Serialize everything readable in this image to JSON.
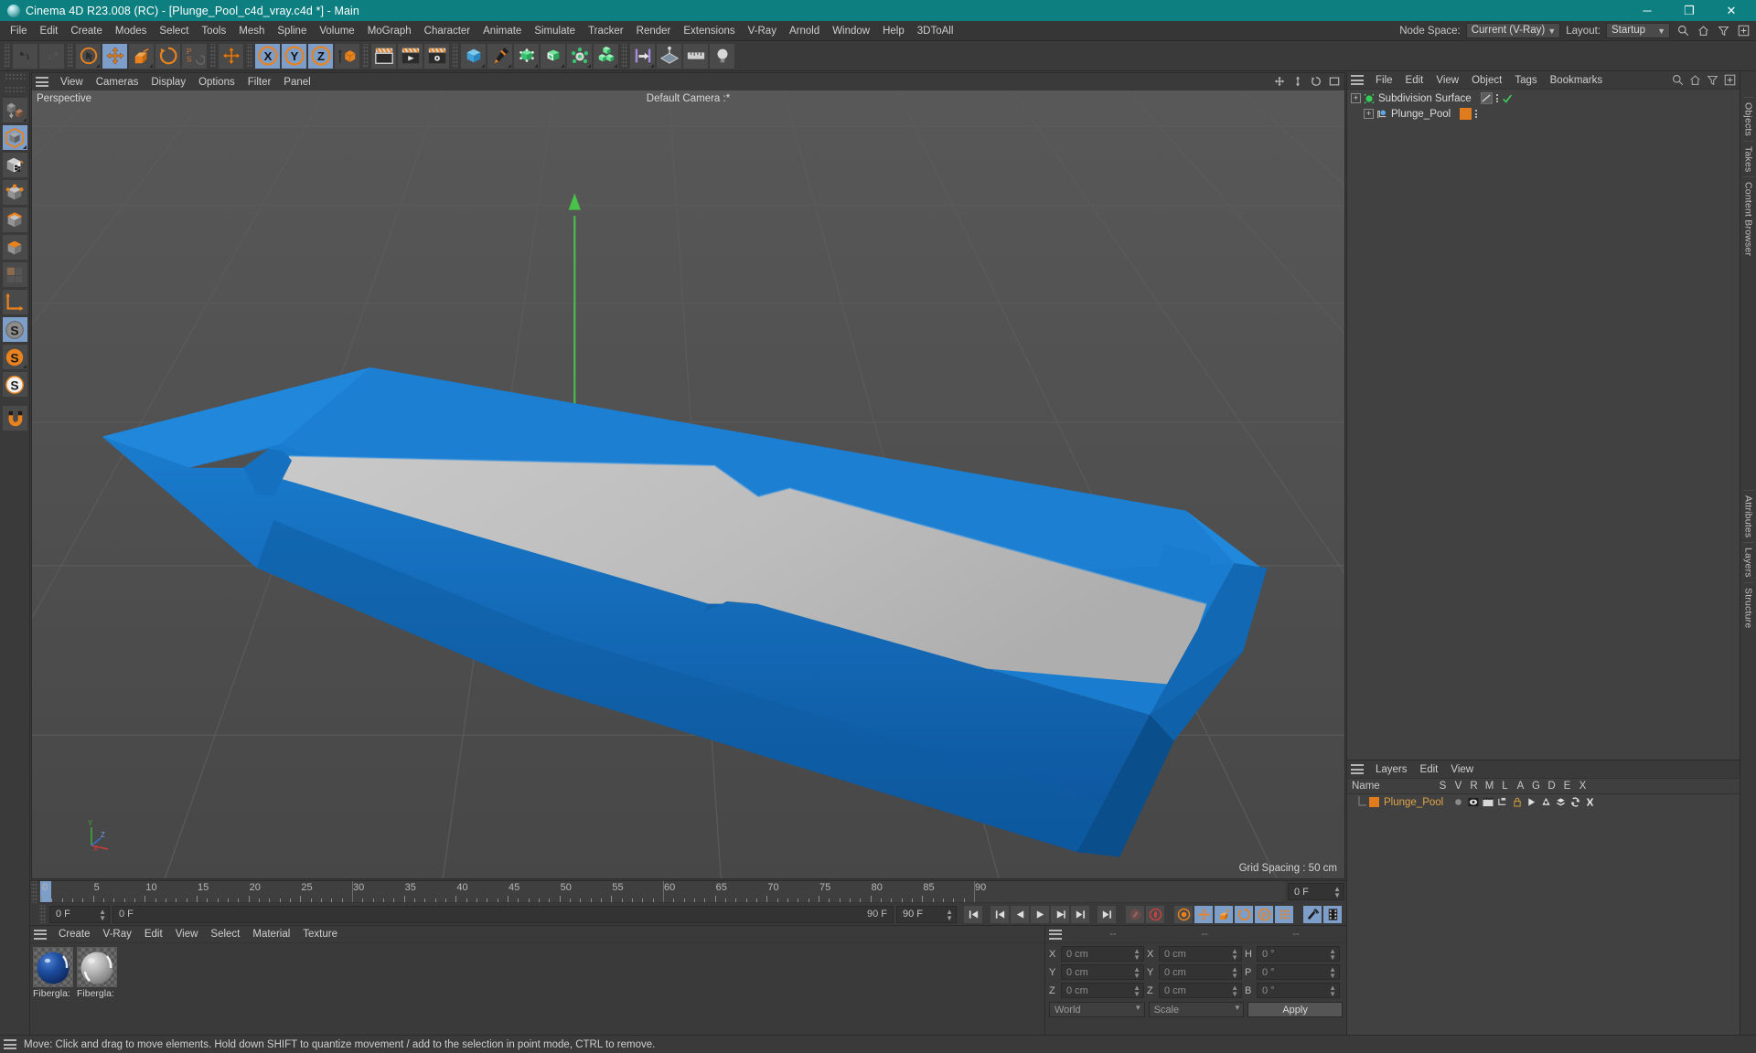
{
  "titlebar": {
    "title": "Cinema 4D R23.008 (RC) - [Plunge_Pool_c4d_vray.c4d *] - Main",
    "minimize": "─",
    "maximize": "❐",
    "close": "✕",
    "logo_icon": "c4d-logo-icon"
  },
  "menubar": {
    "items": [
      "File",
      "Edit",
      "Create",
      "Modes",
      "Select",
      "Tools",
      "Mesh",
      "Spline",
      "Volume",
      "MoGraph",
      "Character",
      "Animate",
      "Simulate",
      "Tracker",
      "Render",
      "Extensions",
      "V-Ray",
      "Arnold",
      "Window",
      "Help",
      "3DToAll"
    ],
    "node_space_label": "Node Space:",
    "node_space_value": "Current (V-Ray)",
    "layout_label": "Layout:",
    "layout_value": "Startup",
    "icons": [
      "search-icon",
      "home-icon",
      "filter-icon",
      "add-icon"
    ]
  },
  "toolbar": {
    "groups": [
      {
        "name": "history",
        "buttons": [
          {
            "name": "undo-button",
            "icon": "undo-arrow",
            "selected": false
          },
          {
            "name": "redo-button",
            "icon": "redo-arrow",
            "selected": false
          }
        ]
      },
      {
        "name": "transform",
        "buttons": [
          {
            "name": "select-tool-button",
            "icon": "live-selection",
            "selected": false
          },
          {
            "name": "move-tool-button",
            "icon": "move-cross",
            "selected": true
          },
          {
            "name": "scale-tool-button",
            "icon": "scale-box",
            "selected": false
          },
          {
            "name": "rotate-tool-button",
            "icon": "rotate-circle",
            "selected": false
          },
          {
            "name": "ps-tool-button",
            "icon": "ps-letters",
            "selected": false
          }
        ]
      },
      {
        "name": "axis",
        "buttons": [
          {
            "name": "world-axis-button",
            "icon": "move-cross",
            "selected": false
          }
        ]
      },
      {
        "name": "locks",
        "buttons": [
          {
            "name": "lock-x-button",
            "icon": "x-axis-lock",
            "selected": true
          },
          {
            "name": "lock-y-button",
            "icon": "y-axis-lock",
            "selected": true
          },
          {
            "name": "lock-z-button",
            "icon": "z-axis-lock",
            "selected": true
          },
          {
            "name": "world-object-button",
            "icon": "world-cube",
            "selected": false
          }
        ]
      },
      {
        "name": "render",
        "buttons": [
          {
            "name": "render-view-button",
            "icon": "render-clapper",
            "selected": false
          },
          {
            "name": "render-to-picture-button",
            "icon": "render-play",
            "selected": false
          },
          {
            "name": "render-settings-button",
            "icon": "render-gear",
            "selected": false
          }
        ]
      },
      {
        "name": "create",
        "buttons": [
          {
            "name": "add-cube-button",
            "icon": "blue-cube",
            "selected": false
          },
          {
            "name": "add-spline-button",
            "icon": "pen-nib",
            "selected": false
          },
          {
            "name": "add-generator-button",
            "icon": "green-cube-points",
            "selected": false
          },
          {
            "name": "add-deformer-button",
            "icon": "green-bend-cube",
            "selected": false
          },
          {
            "name": "add-scene-button",
            "icon": "gray-sphere-nodes",
            "selected": false
          },
          {
            "name": "add-mograph-button",
            "icon": "green-cubes-stack",
            "selected": false
          }
        ]
      },
      {
        "name": "snap",
        "buttons": [
          {
            "name": "snap-button",
            "icon": "magnet-arrow",
            "selected": false
          },
          {
            "name": "workplane-button",
            "icon": "workplane-grid",
            "selected": false
          },
          {
            "name": "ruler-button",
            "icon": "ruler-icon",
            "selected": false
          },
          {
            "name": "light-button",
            "icon": "bulb-icon",
            "selected": false
          }
        ]
      }
    ]
  },
  "leftbar": {
    "buttons": [
      {
        "name": "make-editable-button",
        "icon": "make-editable",
        "selected": false
      },
      {
        "name": "model-mode-button",
        "icon": "gray-cube",
        "selected": true
      },
      {
        "name": "texture-mode-button",
        "icon": "checker-cube",
        "selected": false
      },
      {
        "name": "points-mode-button",
        "icon": "points-cube",
        "selected": false
      },
      {
        "name": "edges-mode-button",
        "icon": "edges-cube",
        "selected": false
      },
      {
        "name": "polygons-mode-button",
        "icon": "polygons-cube",
        "selected": false
      },
      {
        "name": "uv-mode-button",
        "icon": "uv-squares",
        "selected": false
      },
      {
        "name": "axis-mode-button",
        "icon": "axis-corner",
        "selected": false
      },
      {
        "name": "enable-axis-button",
        "icon": "s-circle-gray",
        "selected": true
      },
      {
        "name": "enable-snap-button",
        "icon": "s-circle-orange",
        "selected": false
      },
      {
        "name": "workplane-lock-button",
        "icon": "s-circle-white",
        "selected": false
      },
      {
        "name": "magnet-button",
        "icon": "magnet-orange",
        "selected": false
      }
    ]
  },
  "viewport": {
    "menu_items": [
      "View",
      "Cameras",
      "Display",
      "Options",
      "Filter",
      "Panel"
    ],
    "label_top_left": "Perspective",
    "label_top_center": "Default Camera :*",
    "grid_spacing": "Grid Spacing : 50 cm",
    "axis_labels": {
      "x": "X",
      "y": "Y",
      "z": "Z"
    },
    "gizmo_icons": [
      "pan-icon",
      "dolly-icon",
      "rotate-icon",
      "maximize-icon"
    ],
    "colors": {
      "background_top": "#555555",
      "background_bottom": "#474747",
      "pool_blue": "#1878c8",
      "pool_blue_dark": "#1161a4",
      "pool_inner_gray": "#bcbcbc",
      "axis_green": "#49c24a"
    }
  },
  "timeline": {
    "ticks": [
      0,
      5,
      10,
      15,
      20,
      25,
      30,
      35,
      40,
      45,
      50,
      55,
      60,
      65,
      70,
      75,
      80,
      85,
      90
    ],
    "current_frame": "0 F",
    "range_start": "0 F",
    "range_end": "90 F",
    "preview_min": "90 F",
    "preview_max": "90 F",
    "end_field": "0 F",
    "transport": [
      {
        "name": "goto-start-button",
        "icon": "skip-start"
      },
      {
        "name": "step-back-key-button",
        "icon": "prev-key"
      },
      {
        "name": "step-back-button",
        "icon": "step-back"
      },
      {
        "name": "play-button",
        "icon": "play"
      },
      {
        "name": "step-forward-button",
        "icon": "step-forward"
      },
      {
        "name": "next-key-button",
        "icon": "next-key"
      },
      {
        "name": "goto-end-button",
        "icon": "skip-end"
      }
    ],
    "record_buttons": [
      {
        "name": "record-active-objects-button",
        "icon": "record-key",
        "selected": false
      },
      {
        "name": "autokeying-button",
        "icon": "autokey-circle",
        "selected": false
      },
      {
        "name": "keyframe-selection-button",
        "icon": "key-gear",
        "selected": false
      },
      {
        "name": "position-key-button",
        "icon": "move-cross",
        "selected": true
      },
      {
        "name": "scale-key-button",
        "icon": "scale-box",
        "selected": true
      },
      {
        "name": "rotation-key-button",
        "icon": "rotate-circle",
        "selected": true
      },
      {
        "name": "pla-key-button",
        "icon": "p-circle",
        "selected": true
      },
      {
        "name": "point-level-animation-button",
        "icon": "dots-grid",
        "selected": true
      },
      {
        "name": "sound-button",
        "icon": "sound-waves",
        "selected": true
      },
      {
        "name": "filmstrip-button",
        "icon": "filmstrip",
        "selected": true
      }
    ]
  },
  "material_manager": {
    "menu_items": [
      "Create",
      "V-Ray",
      "Edit",
      "View",
      "Select",
      "Material",
      "Texture"
    ],
    "materials": [
      {
        "name": "Fiberglas",
        "display": "Fibergla:",
        "color": "#1b4f9c",
        "type": "glossy-blue"
      },
      {
        "name": "Fiberglas",
        "display": "Fibergla:",
        "color": "#b8b8b8",
        "type": "glossy-gray"
      }
    ]
  },
  "coordinates": {
    "headers": [
      "--",
      "--",
      "--"
    ],
    "rows": [
      {
        "axis1": "X",
        "val1": "0 cm",
        "axis2": "X",
        "val2": "0 cm",
        "axis3": "H",
        "val3": "0 °"
      },
      {
        "axis1": "Y",
        "val1": "0 cm",
        "axis2": "Y",
        "val2": "0 cm",
        "axis3": "P",
        "val3": "0 °"
      },
      {
        "axis1": "Z",
        "val1": "0 cm",
        "axis2": "Z",
        "val2": "0 cm",
        "axis3": "B",
        "val3": "0 °"
      }
    ],
    "space_value": "World",
    "mode_value": "Scale",
    "apply_label": "Apply"
  },
  "object_manager": {
    "menu_items": [
      "File",
      "Edit",
      "View",
      "Object",
      "Tags",
      "Bookmarks"
    ],
    "objects": [
      {
        "name": "Subdivision Surface",
        "depth": 0,
        "icon": "subdivision-surface-icon",
        "icon_color": "#33cc55",
        "tag": "display-tag",
        "check": true
      },
      {
        "name": "Plunge_Pool",
        "depth": 1,
        "icon": "polygon-object-icon",
        "icon_color": "#5aa8e8",
        "tag": "material-tag-orange",
        "check": false
      }
    ]
  },
  "layer_manager": {
    "menu_items": [
      "Layers",
      "Edit",
      "View"
    ],
    "columns": [
      "Name",
      "S",
      "V",
      "R",
      "M",
      "L",
      "A",
      "G",
      "D",
      "E",
      "X"
    ],
    "rows": [
      {
        "name": "Plunge_Pool",
        "color": "#e07b1e"
      }
    ]
  },
  "vertical_tabs_right": [
    "Objects",
    "Takes",
    "Content Browser"
  ],
  "vertical_tabs_right_lower": [
    "Attributes",
    "Layers",
    "Structure"
  ],
  "statusbar": {
    "message": "Move: Click and drag to move elements. Hold down SHIFT to quantize movement / add to the selection in point mode, CTRL to remove."
  }
}
